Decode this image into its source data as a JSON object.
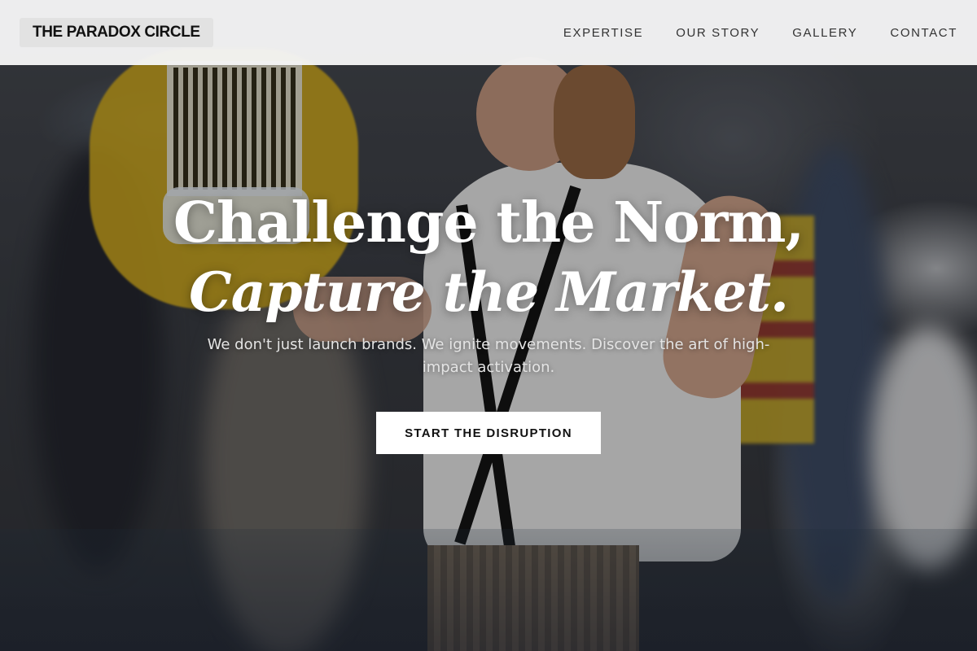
{
  "brand": {
    "name": "THE PARADOX CIRCLE"
  },
  "nav": {
    "items": [
      {
        "label": "EXPERTISE"
      },
      {
        "label": "OUR STORY"
      },
      {
        "label": "GALLERY"
      },
      {
        "label": "CONTACT"
      }
    ]
  },
  "hero": {
    "headline_line1": "Challenge the Norm,",
    "headline_line2": "Capture the Market.",
    "subtitle": "We don't just launch brands. We ignite movements. Discover the art of high-impact activation.",
    "cta_label": "START THE DISRUPTION"
  },
  "colors": {
    "navbar_bg": "#f4f4f4",
    "brand_bg": "#e2e2e2",
    "cta_bg": "#ffffff",
    "headline_text": "#ffffff"
  }
}
